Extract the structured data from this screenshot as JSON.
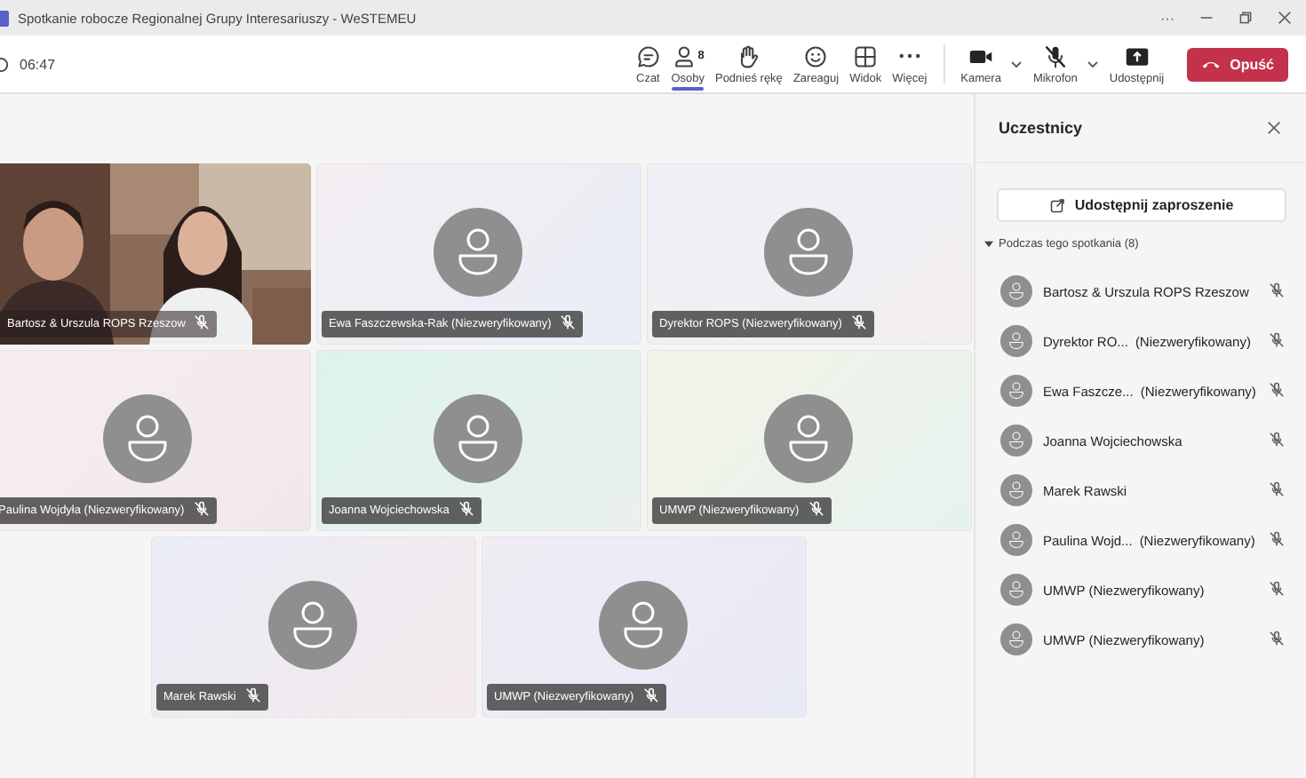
{
  "window": {
    "title": "Spotkanie robocze Regionalnej Grupy Interesariuszy - WeSTEMEU",
    "controls": [
      "···"
    ]
  },
  "toolbar": {
    "time": "06:47",
    "buttons": [
      {
        "kind": "chat",
        "label": "Czat",
        "selected": false
      },
      {
        "kind": "people",
        "label": "Osoby",
        "badge": "8",
        "selected": true
      },
      {
        "kind": "hand",
        "label": "Podnieś rękę",
        "selected": false
      },
      {
        "kind": "react",
        "label": "Zareaguj",
        "selected": false
      },
      {
        "kind": "view",
        "label": "Widok",
        "selected": false
      },
      {
        "kind": "more",
        "label": "Więcej",
        "selected": false
      }
    ],
    "devices": [
      {
        "kind": "camera",
        "label": "Kamera",
        "muted": false,
        "caret": true
      },
      {
        "kind": "mic",
        "label": "Mikrofon",
        "muted": true,
        "caret": true
      },
      {
        "kind": "share",
        "label": "Udostępnij",
        "caret": false
      }
    ],
    "leave": "Opuść"
  },
  "tiles": [
    {
      "kind": "video",
      "name": "Bartosz & Urszula ROPS Rzeszow",
      "muted": true
    },
    {
      "kind": "avatar",
      "name": "Ewa Faszczewska-Rak (Niezweryfikowany)",
      "muted": true
    },
    {
      "kind": "avatar",
      "name": "Dyrektor ROPS (Niezweryfikowany)",
      "muted": true
    },
    {
      "kind": "avatar",
      "name": "Paulina Wojdyła (Niezweryfikowany)",
      "muted": true
    },
    {
      "kind": "avatar",
      "name": "Joanna Wojciechowska",
      "muted": true
    },
    {
      "kind": "avatar",
      "name": "UMWP (Niezweryfikowany)",
      "muted": true
    },
    {
      "kind": "avatar",
      "name": "Marek Rawski",
      "muted": true
    },
    {
      "kind": "avatar",
      "name": "UMWP (Niezweryfikowany)",
      "muted": true
    }
  ],
  "panel": {
    "title": "Uczestnicy",
    "invite": "Udostępnij zaproszenie",
    "section": {
      "label": "Podczas tego spotkania (8)",
      "expanded": true
    },
    "participants": [
      {
        "name": "Bartosz & Urszula ROPS Rzeszow",
        "muted": true
      },
      {
        "name": "Dyrektor RO...",
        "tag": "(Niezweryfikowany)",
        "muted": true
      },
      {
        "name": "Ewa Faszcze...",
        "tag": "(Niezweryfikowany)",
        "muted": true
      },
      {
        "name": "Joanna Wojciechowska",
        "muted": true
      },
      {
        "name": "Marek Rawski",
        "muted": true
      },
      {
        "name": "Paulina Wojd...",
        "tag": "(Niezweryfikowany)",
        "muted": true
      },
      {
        "name": "UMWP (Niezweryfikowany)",
        "muted": true
      },
      {
        "name": "UMWP (Niezweryfikowany)",
        "muted": true
      }
    ]
  }
}
